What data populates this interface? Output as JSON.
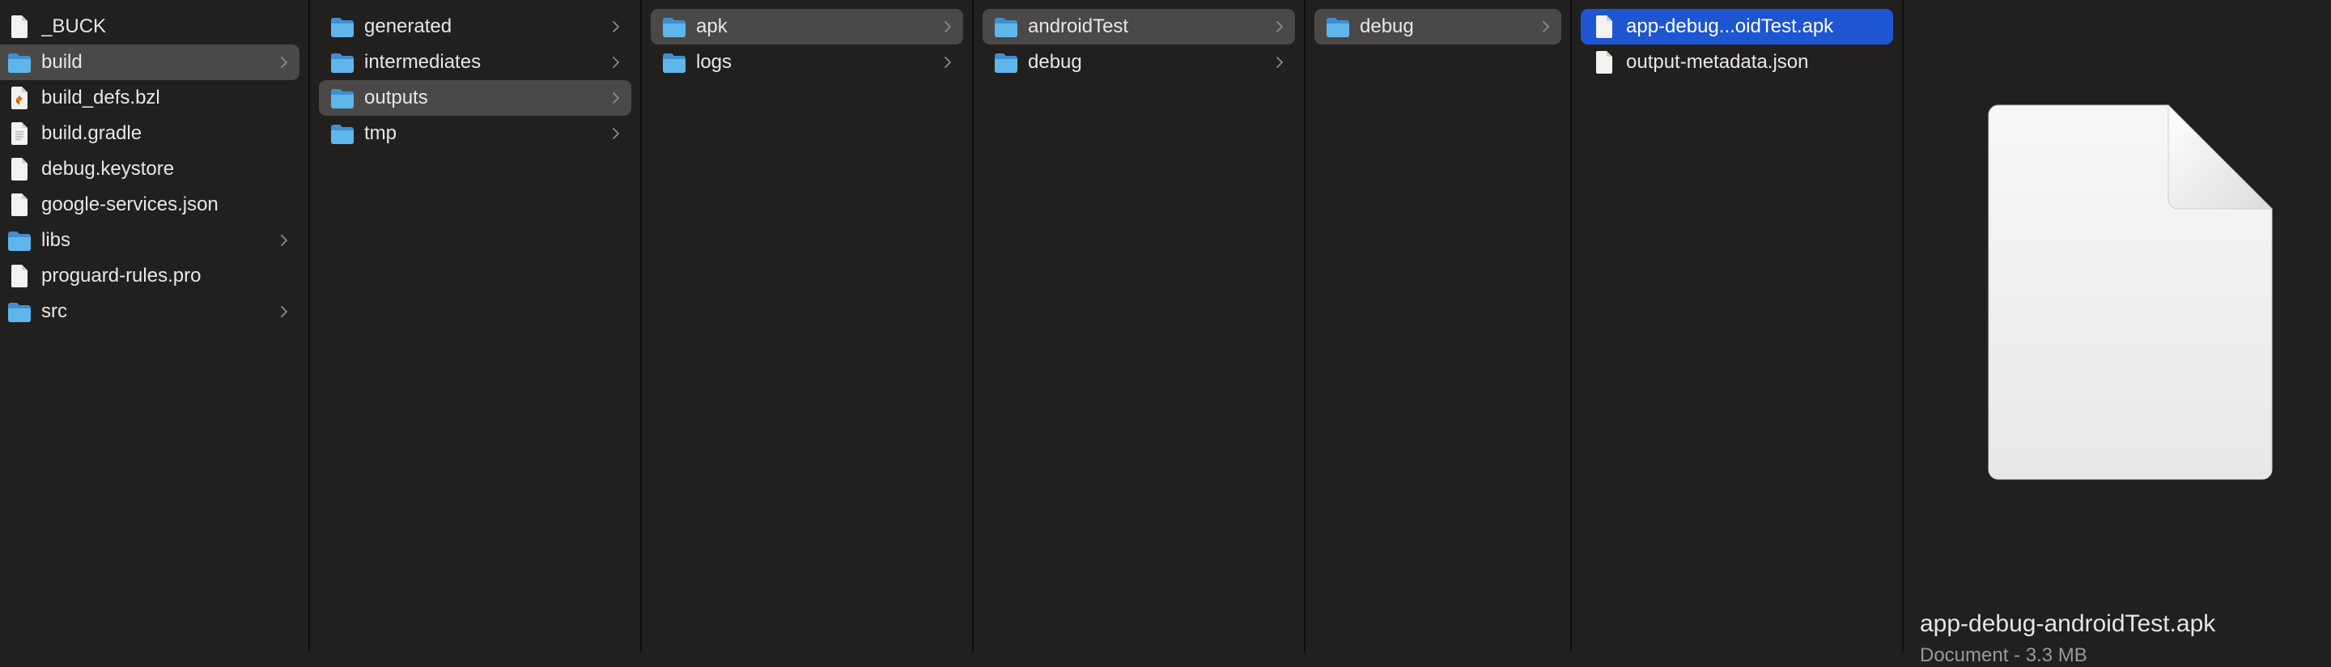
{
  "columns": [
    {
      "items": [
        {
          "label": "_BUCK",
          "kind": "file",
          "state": ""
        },
        {
          "label": "build",
          "kind": "folder",
          "state": "gray",
          "chevron": true
        },
        {
          "label": "build_defs.bzl",
          "kind": "bzl",
          "state": ""
        },
        {
          "label": "build.gradle",
          "kind": "textfile",
          "state": ""
        },
        {
          "label": "debug.keystore",
          "kind": "file",
          "state": ""
        },
        {
          "label": "google-services.json",
          "kind": "file",
          "state": ""
        },
        {
          "label": "libs",
          "kind": "folder",
          "state": "",
          "chevron": true
        },
        {
          "label": "proguard-rules.pro",
          "kind": "file",
          "state": ""
        },
        {
          "label": "src",
          "kind": "folder",
          "state": "",
          "chevron": true
        }
      ]
    },
    {
      "items": [
        {
          "label": "generated",
          "kind": "folder",
          "state": "",
          "chevron": true
        },
        {
          "label": "intermediates",
          "kind": "folder",
          "state": "",
          "chevron": true
        },
        {
          "label": "outputs",
          "kind": "folder",
          "state": "gray",
          "chevron": true
        },
        {
          "label": "tmp",
          "kind": "folder",
          "state": "",
          "chevron": true
        }
      ]
    },
    {
      "items": [
        {
          "label": "apk",
          "kind": "folder",
          "state": "gray",
          "chevron": true
        },
        {
          "label": "logs",
          "kind": "folder",
          "state": "",
          "chevron": true
        }
      ]
    },
    {
      "items": [
        {
          "label": "androidTest",
          "kind": "folder",
          "state": "gray",
          "chevron": true
        },
        {
          "label": "debug",
          "kind": "folder",
          "state": "",
          "chevron": true
        }
      ]
    },
    {
      "items": [
        {
          "label": "debug",
          "kind": "folder",
          "state": "gray",
          "chevron": true
        }
      ]
    },
    {
      "items": [
        {
          "label": "app-debug...oidTest.apk",
          "kind": "file",
          "state": "blue"
        },
        {
          "label": "output-metadata.json",
          "kind": "file",
          "state": ""
        }
      ]
    }
  ],
  "preview": {
    "filename": "app-debug-androidTest.apk",
    "subtitle": "Document - 3.3 MB",
    "icon": "document-preview-icon"
  },
  "colors": {
    "background": "#221f1f",
    "selection_gray": "#4b4948",
    "selection_blue": "#1d56d0",
    "folder": "#5fb6ea"
  }
}
